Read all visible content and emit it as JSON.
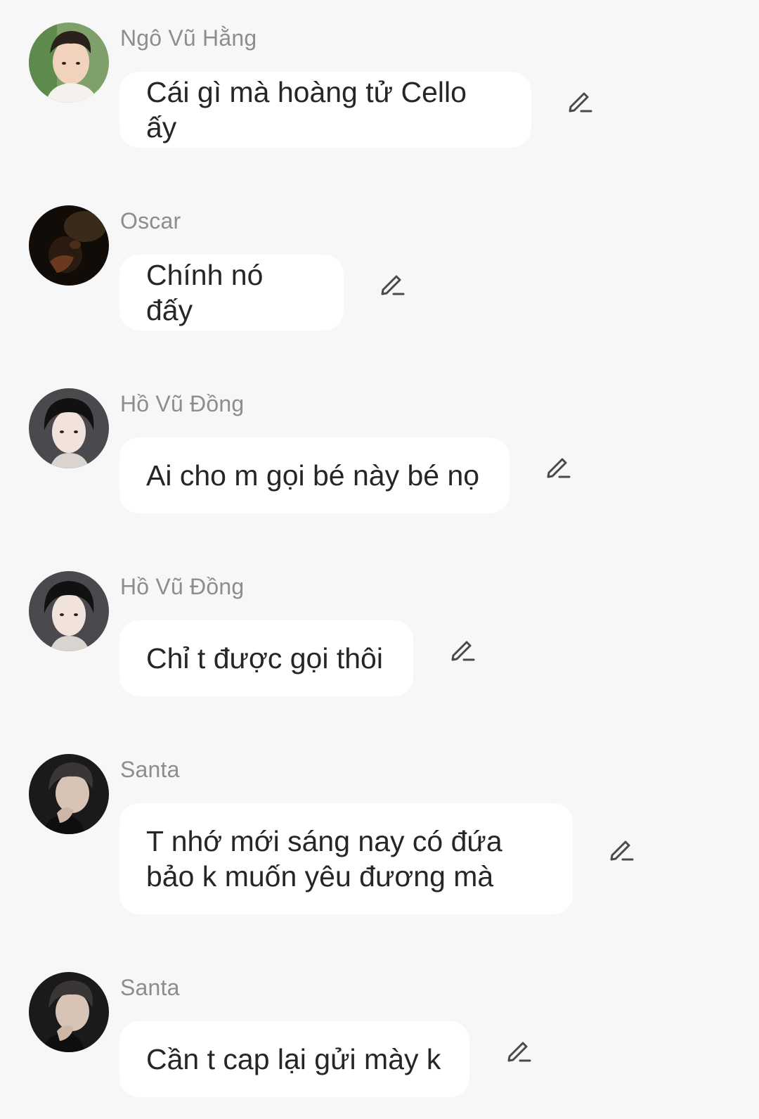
{
  "colors": {
    "background": "#f7f7f7",
    "bubble": "#ffffff",
    "sender_name": "#8d8d8d",
    "message_text": "#262626",
    "edit_icon": "#4a4a4a"
  },
  "messages": [
    {
      "sender": "Ngô Vũ Hằng",
      "avatar_icon": "avatar-ngo-vu-hang",
      "text": "Cái gì mà hoàng tử Cello ấy",
      "action_icon": "edit-pencil-icon"
    },
    {
      "sender": "Oscar",
      "avatar_icon": "avatar-oscar",
      "text": "Chính nó đấy",
      "action_icon": "edit-pencil-icon"
    },
    {
      "sender": "Hồ Vũ Đồng",
      "avatar_icon": "avatar-ho-vu-dong",
      "text": "Ai cho m gọi bé này bé nọ",
      "action_icon": "edit-pencil-icon"
    },
    {
      "sender": "Hồ Vũ Đồng",
      "avatar_icon": "avatar-ho-vu-dong",
      "text": "Chỉ t được gọi thôi",
      "action_icon": "edit-pencil-icon"
    },
    {
      "sender": "Santa",
      "avatar_icon": "avatar-santa",
      "text": "T nhớ mới sáng nay có đứa\nbảo k muốn yêu đương mà",
      "action_icon": "edit-pencil-icon"
    },
    {
      "sender": "Santa",
      "avatar_icon": "avatar-santa",
      "text": "Cần t cap lại gửi mày k",
      "action_icon": "edit-pencil-icon"
    }
  ]
}
